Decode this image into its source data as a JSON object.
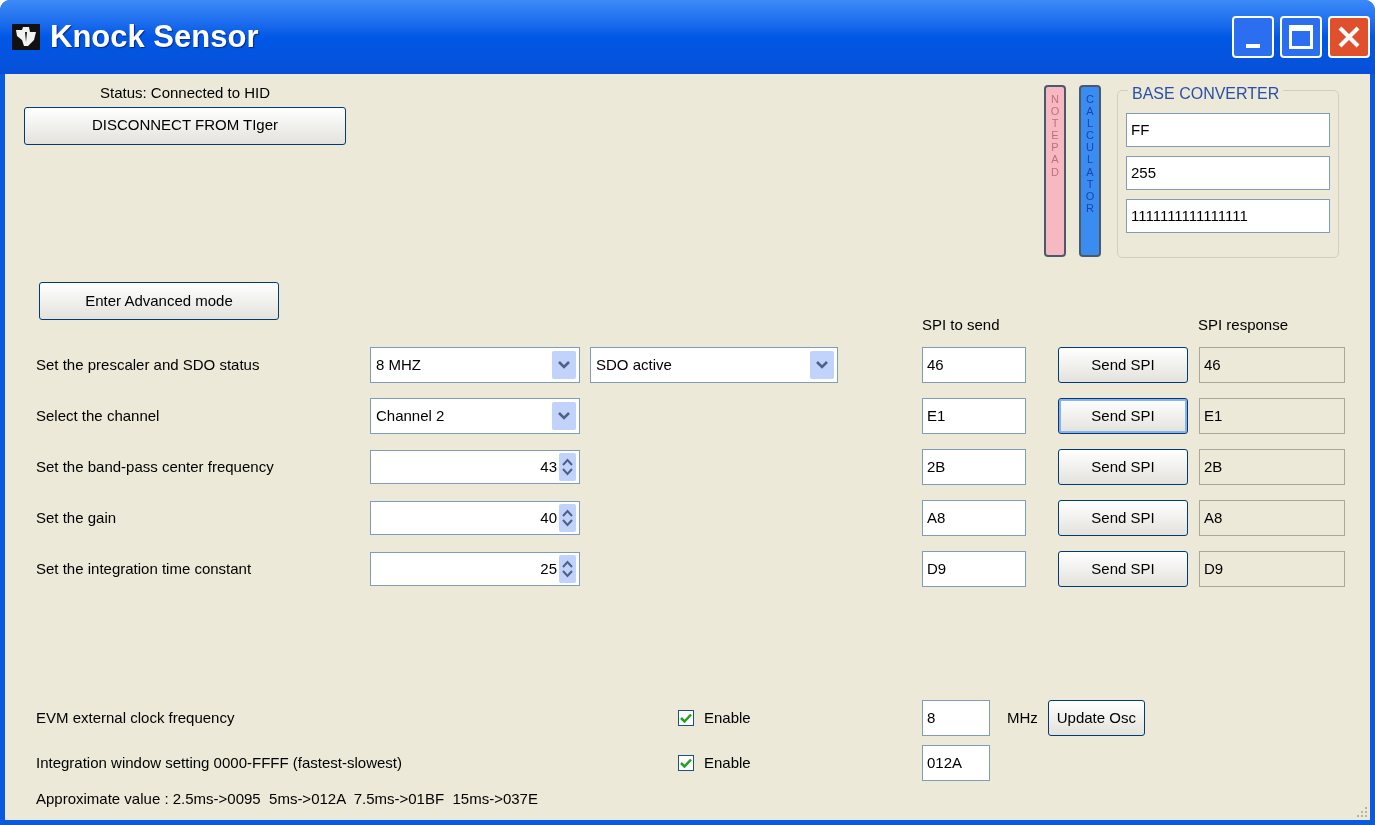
{
  "window": {
    "title": "Knock Sensor"
  },
  "status": "Status: Connected to HID",
  "disconnect_button": "DISCONNECT FROM TIger",
  "side_buttons": [
    {
      "label": "NOTEPAD",
      "kind": "notepad"
    },
    {
      "label": "CALCULATOR",
      "kind": "calculator"
    }
  ],
  "base_converter": {
    "title": "BASE CONVERTER",
    "fields": [
      "FF",
      "255",
      "1111111111111111"
    ]
  },
  "advanced_button": "Enter Advanced mode",
  "spi_headers": {
    "send": "SPI to send",
    "response": "SPI response"
  },
  "rows": [
    {
      "label": "Set the prescaler and SDO status",
      "controls": [
        {
          "kind": "dropdown",
          "value": "8 MHZ"
        },
        {
          "kind": "dropdown",
          "value": "SDO active"
        }
      ],
      "spi": "46",
      "button": "Send SPI",
      "focused": false,
      "response": "46"
    },
    {
      "label": "Select the channel",
      "controls": [
        {
          "kind": "dropdown",
          "value": "Channel 2"
        }
      ],
      "spi": "E1",
      "button": "Send SPI",
      "focused": true,
      "response": "E1"
    },
    {
      "label": "Set the band-pass center frequency",
      "controls": [
        {
          "kind": "spinner",
          "value": "43"
        }
      ],
      "spi": "2B",
      "button": "Send SPI",
      "focused": false,
      "response": "2B"
    },
    {
      "label": "Set the gain",
      "controls": [
        {
          "kind": "spinner",
          "value": "40"
        }
      ],
      "spi": "A8",
      "button": "Send SPI",
      "focused": false,
      "response": "A8"
    },
    {
      "label": "Set the integration time constant",
      "controls": [
        {
          "kind": "spinner",
          "value": "25"
        }
      ],
      "spi": "D9",
      "button": "Send SPI",
      "focused": false,
      "response": "D9"
    }
  ],
  "settings": [
    {
      "label": "EVM external clock frequency",
      "checkbox": "Enable",
      "checked": true,
      "value": "8",
      "unit": "MHz",
      "button": "Update Osc"
    },
    {
      "label": "Integration window setting 0000-FFFF (fastest-slowest)",
      "checkbox": "Enable",
      "checked": true,
      "value": "012A"
    }
  ],
  "note": "Approximate value : 2.5ms->0095  5ms->012A  7.5ms->01BF  15ms->037E"
}
